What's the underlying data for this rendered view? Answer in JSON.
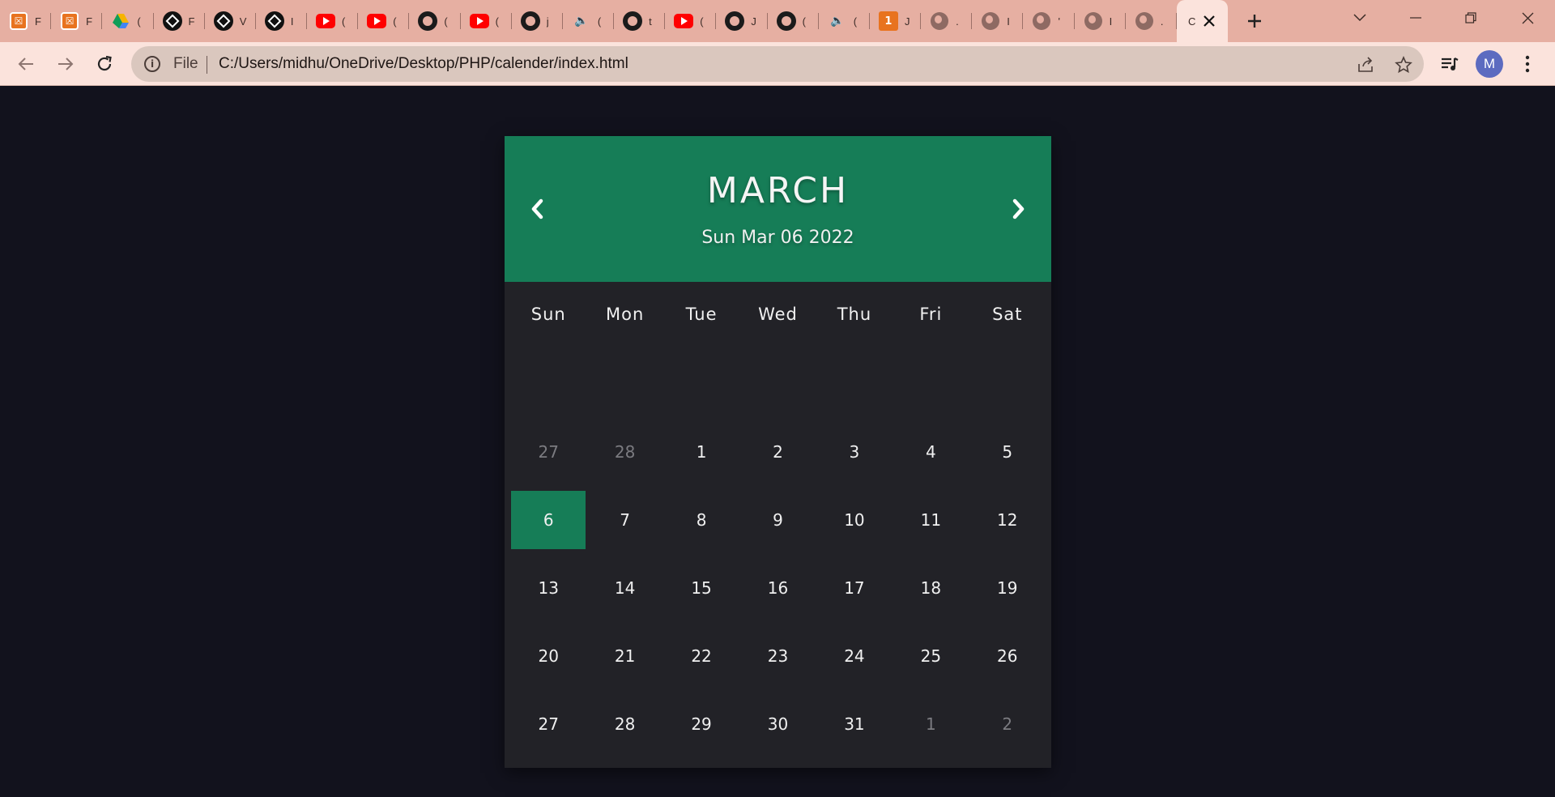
{
  "browser": {
    "tabs": [
      {
        "favicon": "xampp-icon",
        "title_fragment": "F"
      },
      {
        "favicon": "xampp-icon",
        "title_fragment": "F"
      },
      {
        "favicon": "google-drive-icon",
        "title_fragment": "("
      },
      {
        "favicon": "codepen-icon",
        "title_fragment": "F"
      },
      {
        "favicon": "codepen-icon",
        "title_fragment": "V"
      },
      {
        "favicon": "codepen-icon",
        "title_fragment": "I"
      },
      {
        "favicon": "youtube-icon",
        "title_fragment": "("
      },
      {
        "favicon": "youtube-icon",
        "title_fragment": "("
      },
      {
        "favicon": "github-icon",
        "title_fragment": "("
      },
      {
        "favicon": "youtube-icon",
        "title_fragment": "("
      },
      {
        "favicon": "github-icon",
        "title_fragment": "j"
      },
      {
        "favicon": "audio-icon",
        "title_fragment": "("
      },
      {
        "favicon": "github-icon",
        "title_fragment": "t"
      },
      {
        "favicon": "youtube-icon",
        "title_fragment": "("
      },
      {
        "favicon": "github-icon",
        "title_fragment": "J"
      },
      {
        "favicon": "github-icon",
        "title_fragment": "("
      },
      {
        "favicon": "audio-icon",
        "title_fragment": "("
      },
      {
        "favicon": "number-icon",
        "title_fragment": "J"
      },
      {
        "favicon": "globe-icon",
        "title_fragment": "."
      },
      {
        "favicon": "globe-icon",
        "title_fragment": "I"
      },
      {
        "favicon": "globe-icon",
        "title_fragment": "'"
      },
      {
        "favicon": "globe-icon",
        "title_fragment": "I"
      },
      {
        "favicon": "globe-icon",
        "title_fragment": "."
      }
    ],
    "active_tab_fragment": "C",
    "address": {
      "scheme_label": "File",
      "url": "C:/Users/midhu/OneDrive/Desktop/PHP/calender/index.html"
    },
    "profile_initial": "M"
  },
  "calendar": {
    "month": "MARCH",
    "date_text": "Sun Mar 06 2022",
    "weekdays": [
      "Sun",
      "Mon",
      "Tue",
      "Wed",
      "Thu",
      "Fri",
      "Sat"
    ],
    "days": [
      {
        "n": "27",
        "type": "prev"
      },
      {
        "n": "28",
        "type": "prev"
      },
      {
        "n": "1",
        "type": "cur"
      },
      {
        "n": "2",
        "type": "cur"
      },
      {
        "n": "3",
        "type": "cur"
      },
      {
        "n": "4",
        "type": "cur"
      },
      {
        "n": "5",
        "type": "cur"
      },
      {
        "n": "6",
        "type": "today"
      },
      {
        "n": "7",
        "type": "cur"
      },
      {
        "n": "8",
        "type": "cur"
      },
      {
        "n": "9",
        "type": "cur"
      },
      {
        "n": "10",
        "type": "cur"
      },
      {
        "n": "11",
        "type": "cur"
      },
      {
        "n": "12",
        "type": "cur"
      },
      {
        "n": "13",
        "type": "cur"
      },
      {
        "n": "14",
        "type": "cur"
      },
      {
        "n": "15",
        "type": "cur"
      },
      {
        "n": "16",
        "type": "cur"
      },
      {
        "n": "17",
        "type": "cur"
      },
      {
        "n": "18",
        "type": "cur"
      },
      {
        "n": "19",
        "type": "cur"
      },
      {
        "n": "20",
        "type": "cur"
      },
      {
        "n": "21",
        "type": "cur"
      },
      {
        "n": "22",
        "type": "cur"
      },
      {
        "n": "23",
        "type": "cur"
      },
      {
        "n": "24",
        "type": "cur"
      },
      {
        "n": "25",
        "type": "cur"
      },
      {
        "n": "26",
        "type": "cur"
      },
      {
        "n": "27",
        "type": "cur"
      },
      {
        "n": "28",
        "type": "cur"
      },
      {
        "n": "29",
        "type": "cur"
      },
      {
        "n": "30",
        "type": "cur"
      },
      {
        "n": "31",
        "type": "cur"
      },
      {
        "n": "1",
        "type": "next"
      },
      {
        "n": "2",
        "type": "next"
      }
    ],
    "colors": {
      "accent": "#167d57",
      "panel": "#222227",
      "page_background": "#12121d",
      "muted_day": "#7b7b80"
    }
  }
}
